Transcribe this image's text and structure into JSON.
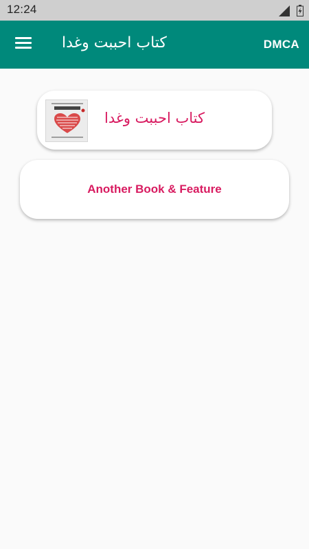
{
  "status_bar": {
    "time": "12:24",
    "icons": [
      "signal-icon",
      "battery-icon"
    ]
  },
  "app_bar": {
    "title": "كتاب احببت وغدا",
    "menu_icon": "hamburger-menu-icon",
    "action_label": "DMCA",
    "color": "#00897b"
  },
  "cards": {
    "book": {
      "label": "كتاب احببت وغدا",
      "cover_icon": "book-cover-icon",
      "cover_title": "احببت وغدا"
    },
    "other": {
      "label": "Another Book & Feature"
    }
  },
  "accent_color": "#d81b60"
}
